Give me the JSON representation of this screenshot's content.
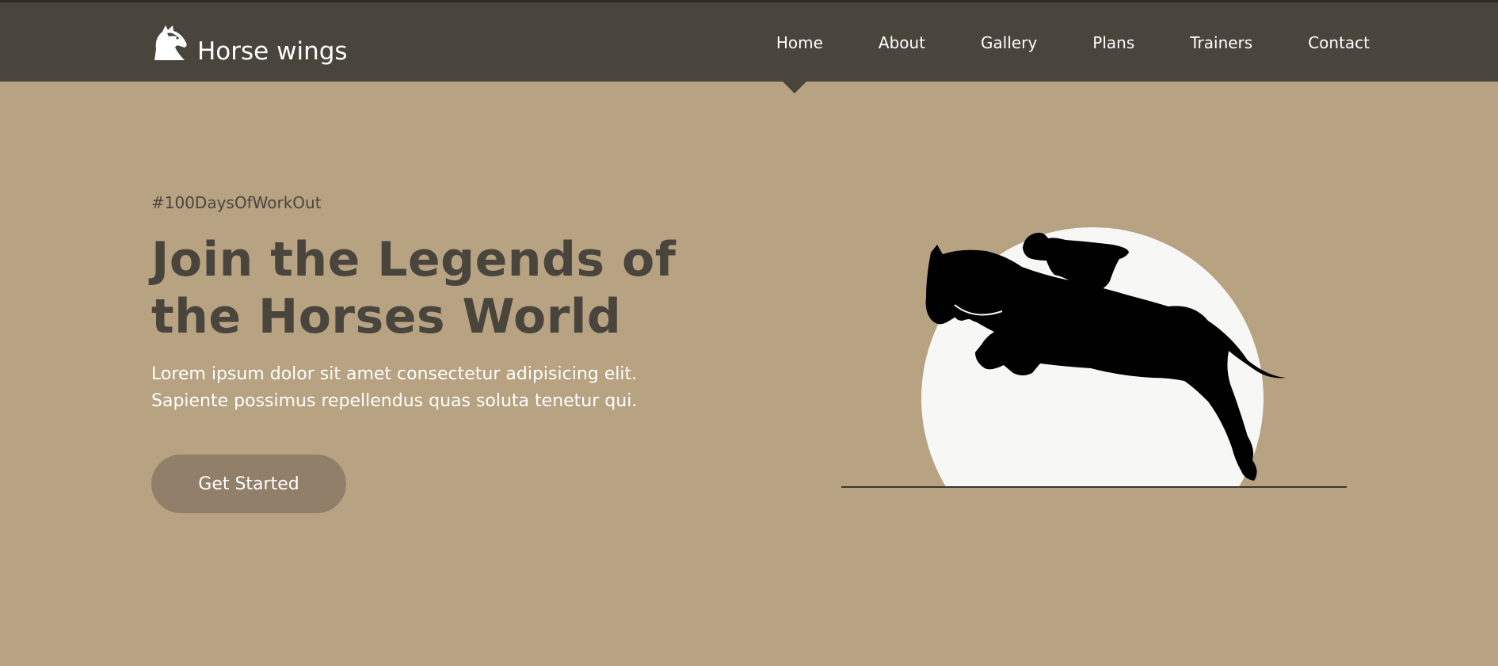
{
  "brand": {
    "name": "Horse wings",
    "logo_icon": "horse-head-icon"
  },
  "nav": {
    "items": [
      {
        "label": "Home",
        "active": true
      },
      {
        "label": "About"
      },
      {
        "label": "Gallery"
      },
      {
        "label": "Plans"
      },
      {
        "label": "Trainers"
      },
      {
        "label": "Contact"
      }
    ]
  },
  "hero": {
    "hashtag": "#100DaysOfWorkOut",
    "title_line1": "Join the Legends of",
    "title_line2": "the Horses World",
    "body_line1": "Lorem ipsum dolor sit amet consectetur adipisicing elit.",
    "body_line2": "Sapiente possimus repellendus quas soluta tenetur qui.",
    "cta_label": "Get Started",
    "illustration_icon": "horse-rider-jumping-icon"
  },
  "colors": {
    "background": "#b7a282",
    "navbar": "#49443c",
    "button": "#917f6a",
    "title": "#49443c",
    "text_light": "#ffffff"
  }
}
